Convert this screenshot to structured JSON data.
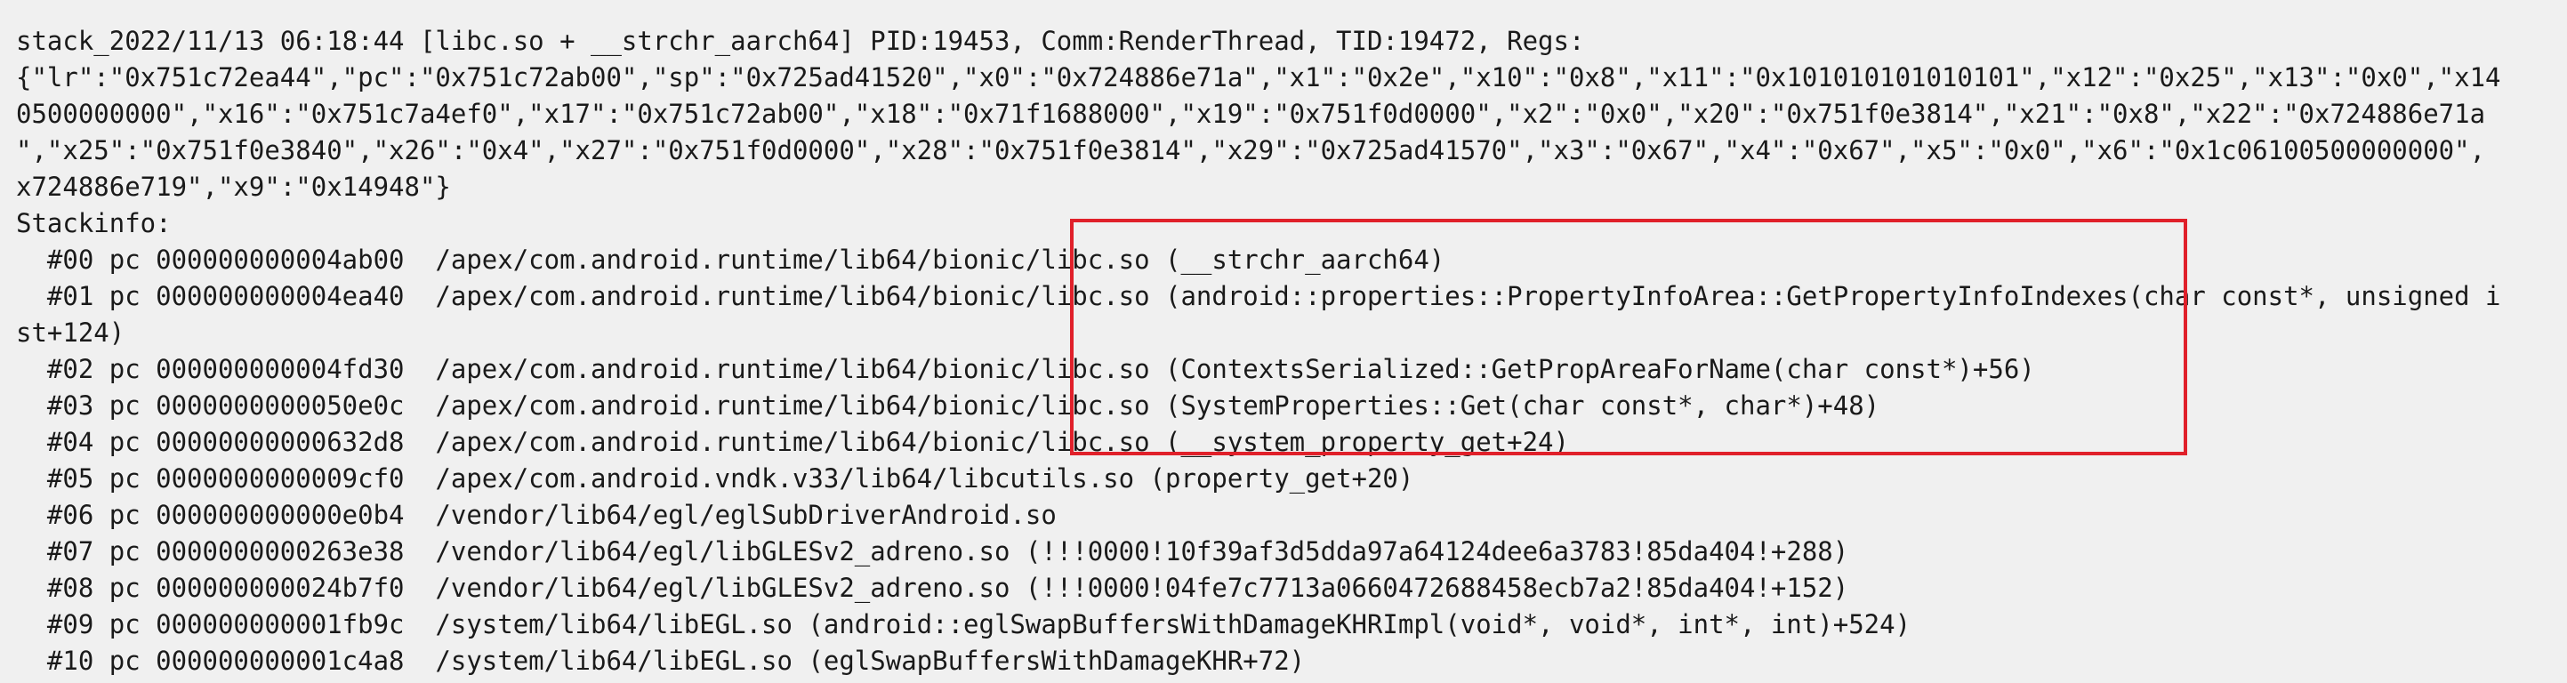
{
  "log": {
    "header": [
      "stack_2022/11/13 06:18:44 [libc.so + __strchr_aarch64] PID:19453, Comm:RenderThread, TID:19472, Regs:",
      "{\"lr\":\"0x751c72ea44\",\"pc\":\"0x751c72ab00\",\"sp\":\"0x725ad41520\",\"x0\":\"0x724886e71a\",\"x1\":\"0x2e\",\"x10\":\"0x8\",\"x11\":\"0x101010101010101\",\"x12\":\"0x25\",\"x13\":\"0x0\",\"x14",
      "0500000000\",\"x16\":\"0x751c7a4ef0\",\"x17\":\"0x751c72ab00\",\"x18\":\"0x71f1688000\",\"x19\":\"0x751f0d0000\",\"x2\":\"0x0\",\"x20\":\"0x751f0e3814\",\"x21\":\"0x8\",\"x22\":\"0x724886e71a",
      "\",\"x25\":\"0x751f0e3840\",\"x26\":\"0x4\",\"x27\":\"0x751f0d0000\",\"x28\":\"0x751f0e3814\",\"x29\":\"0x725ad41570\",\"x3\":\"0x67\",\"x4\":\"0x67\",\"x5\":\"0x0\",\"x6\":\"0x1c06100500000000\",",
      "x724886e719\",\"x9\":\"0x14948\"}"
    ],
    "stackinfo_label": "Stackinfo:",
    "frames": [
      "  #00 pc 000000000004ab00  /apex/com.android.runtime/lib64/bionic/libc.so (__strchr_aarch64)",
      "  #01 pc 000000000004ea40  /apex/com.android.runtime/lib64/bionic/libc.so (android::properties::PropertyInfoArea::GetPropertyInfoIndexes(char const*, unsigned i",
      "st+124)",
      "  #02 pc 000000000004fd30  /apex/com.android.runtime/lib64/bionic/libc.so (ContextsSerialized::GetPropAreaForName(char const*)+56)",
      "  #03 pc 0000000000050e0c  /apex/com.android.runtime/lib64/bionic/libc.so (SystemProperties::Get(char const*, char*)+48)",
      "  #04 pc 00000000000632d8  /apex/com.android.runtime/lib64/bionic/libc.so (__system_property_get+24)",
      "  #05 pc 0000000000009cf0  /apex/com.android.vndk.v33/lib64/libcutils.so (property_get+20)",
      "  #06 pc 000000000000e0b4  /vendor/lib64/egl/eglSubDriverAndroid.so",
      "  #07 pc 0000000000263e38  /vendor/lib64/egl/libGLESv2_adreno.so (!!!0000!10f39af3d5dda97a64124dee6a3783!85da404!+288)",
      "  #08 pc 000000000024b7f0  /vendor/lib64/egl/libGLESv2_adreno.so (!!!0000!04fe7c7713a0660472688458ecb7a2!85da404!+152)",
      "  #09 pc 000000000001fb9c  /system/lib64/libEGL.so (android::eglSwapBuffersWithDamageKHRImpl(void*, void*, int*, int)+524)",
      "  #10 pc 000000000001c4a8  /system/lib64/libEGL.so (eglSwapBuffersWithDamageKHR+72)"
    ]
  },
  "colors": {
    "background": "#f0f0f0",
    "text": "#1a1a1a",
    "highlight_border": "#e0202a"
  }
}
